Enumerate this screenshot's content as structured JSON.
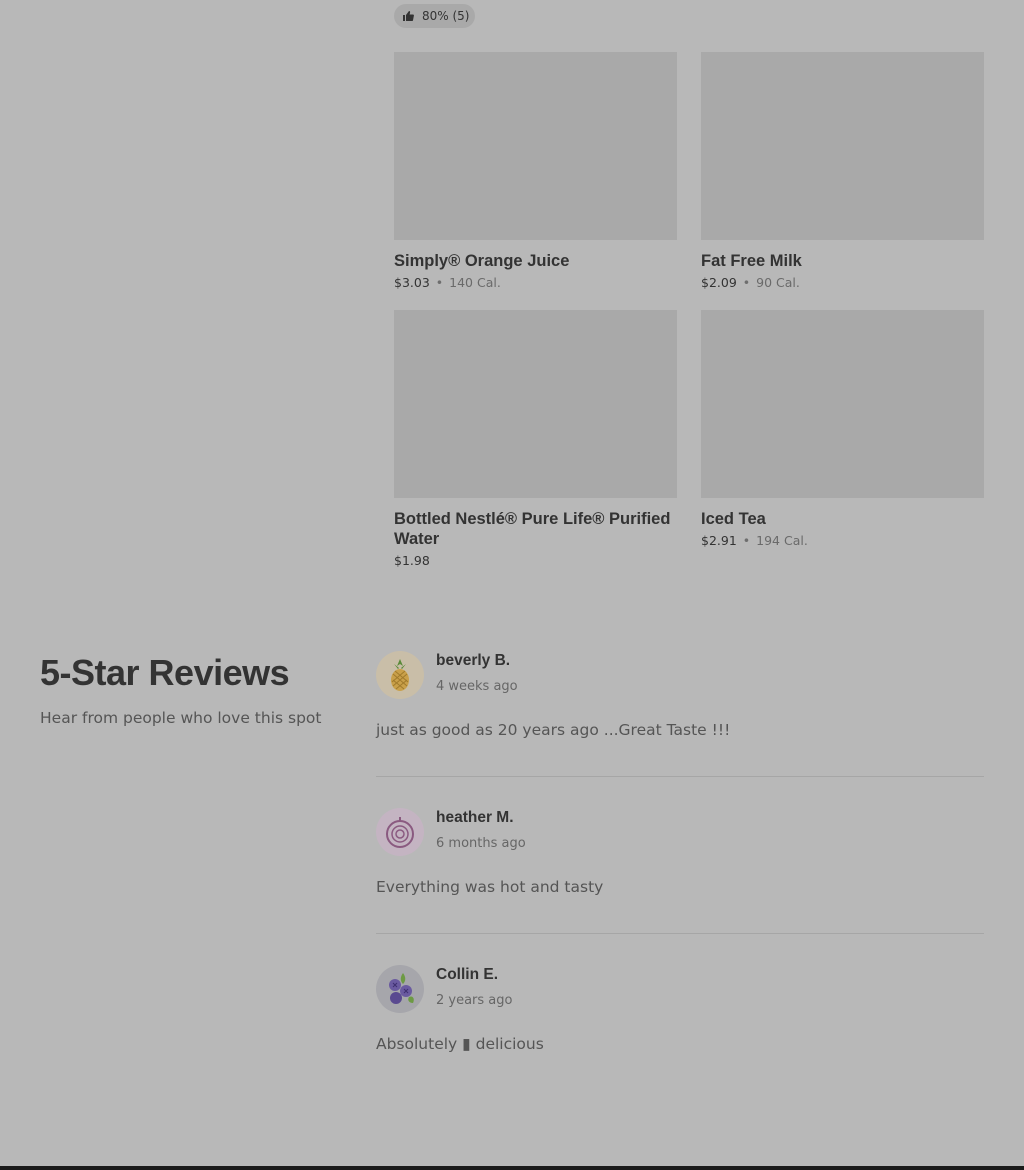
{
  "rating": {
    "label": "80% (5)",
    "icon": "thumbs-up-icon"
  },
  "items": [
    {
      "name": "Simply® Orange Juice",
      "price": "$3.03",
      "separator": "•",
      "calories": "140 Cal."
    },
    {
      "name": "Fat Free Milk",
      "price": "$2.09",
      "separator": "•",
      "calories": "90 Cal."
    },
    {
      "name": "Bottled Nestlé® Pure Life® Purified Water",
      "price": "$1.98"
    },
    {
      "name": "Iced Tea",
      "price": "$2.91",
      "separator": "•",
      "calories": "194 Cal."
    }
  ],
  "reviews_section": {
    "title": "5-Star Reviews",
    "subtitle": "Hear from people who love this spot"
  },
  "reviews": [
    {
      "author": "beverly B.",
      "when": "4 weeks ago",
      "text": "just as good as 20 years ago ...Great Taste !!!",
      "avatar_icon": "pineapple-icon"
    },
    {
      "author": "heather M.",
      "when": "6 months ago",
      "text": "Everything was hot and tasty",
      "avatar_icon": "onion-icon"
    },
    {
      "author": "Collin E.",
      "when": "2 years ago",
      "text": "Absolutely ▮ delicious",
      "avatar_icon": "blueberry-icon"
    }
  ]
}
